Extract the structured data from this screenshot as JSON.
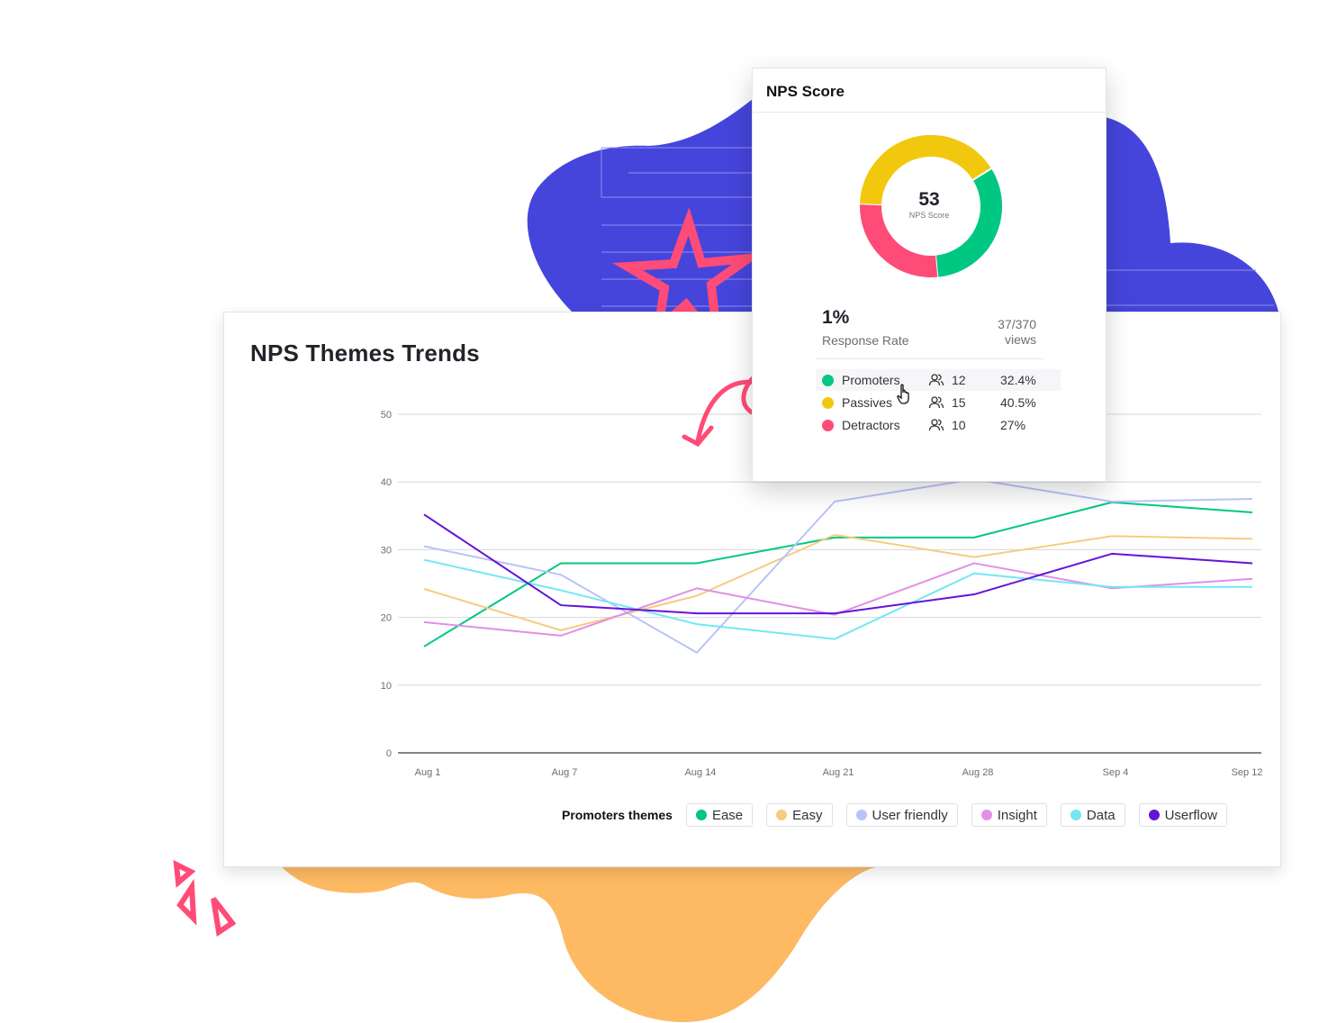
{
  "trend_card": {
    "title": "NPS Themes Trends",
    "legend_title": "Promoters themes"
  },
  "nps_card": {
    "title": "NPS Score",
    "score": "53",
    "score_label": "NPS Score",
    "response_rate_value": "1%",
    "response_rate_label": "Response Rate",
    "views_count": "37/370",
    "views_label": "views",
    "rows": [
      {
        "name": "Promoters",
        "count": "12",
        "percent": "32.4%",
        "color": "#00c781",
        "icon": "users-icon"
      },
      {
        "name": "Passives",
        "count": "15",
        "percent": "40.5%",
        "color": "#f2c80f",
        "icon": "users-icon"
      },
      {
        "name": "Detractors",
        "count": "10",
        "percent": "27%",
        "color": "#ff4b77",
        "icon": "users-icon"
      }
    ]
  },
  "decor": {
    "blue_blob": "#4545dc",
    "orange_blob": "#fdba63",
    "pink_scribble": "#ff4b77"
  },
  "chart_data": [
    {
      "type": "line",
      "title": "NPS Themes Trends",
      "xlabel": "",
      "ylabel": "",
      "ylim": [
        0,
        50
      ],
      "yticks": [
        0,
        10,
        20,
        30,
        40,
        50
      ],
      "grid": true,
      "legend": "bottom-right",
      "categories": [
        "Aug 1",
        "Aug 7",
        "Aug 14",
        "Aug 21",
        "Aug 28",
        "Sep 4",
        "Sep 12"
      ],
      "series": [
        {
          "name": "Ease",
          "color": "#00c781",
          "values": [
            15.7,
            28,
            28,
            31.8,
            31.8,
            37,
            35.5
          ]
        },
        {
          "name": "Easy",
          "color": "#f5cd80",
          "values": [
            24.2,
            18.1,
            23.2,
            32.2,
            28.9,
            32,
            31.6
          ]
        },
        {
          "name": "User friendly",
          "color": "#bac3f7",
          "values": [
            30.5,
            26.3,
            14.8,
            37.1,
            40.4,
            37.1,
            37.5
          ]
        },
        {
          "name": "Insight",
          "color": "#e28fe6",
          "values": [
            19.3,
            17.3,
            24.3,
            20.4,
            28,
            24.3,
            25.7
          ]
        },
        {
          "name": "Data",
          "color": "#73e8f2",
          "values": [
            28.5,
            24,
            19,
            16.8,
            26.5,
            24.5,
            24.5
          ]
        },
        {
          "name": "Userflow",
          "color": "#6314d7",
          "values": [
            35.2,
            21.8,
            20.6,
            20.6,
            23.4,
            29.4,
            28
          ]
        }
      ]
    },
    {
      "type": "pie",
      "title": "NPS Score",
      "center_value": "53",
      "center_label": "NPS Score",
      "categories": [
        "Promoters",
        "Passives",
        "Detractors"
      ],
      "values": [
        32.4,
        40.5,
        27
      ],
      "colors": [
        "#00c781",
        "#f2c80f",
        "#ff4b77"
      ]
    }
  ]
}
